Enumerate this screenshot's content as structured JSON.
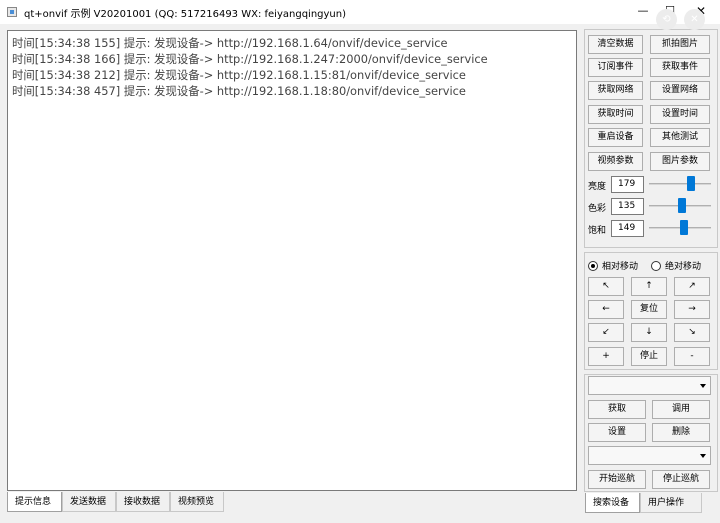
{
  "window": {
    "title": "qt+onvif 示例 V20201001 (QQ: 517216493 WX: feiyangqingyun)",
    "minimize": "—",
    "maximize": "☐",
    "close": "✕"
  },
  "overlay": {
    "icon1": "⟲",
    "icon2": "✕"
  },
  "log": {
    "lines": [
      "时间[15:34:38 155] 提示: 发现设备-> http://192.168.1.64/onvif/device_service",
      "时间[15:34:38 166] 提示: 发现设备-> http://192.168.1.247:2000/onvif/device_service",
      "时间[15:34:38 212] 提示: 发现设备-> http://192.168.1.15:81/onvif/device_service",
      "时间[15:34:38 457] 提示: 发现设备-> http://192.168.1.18:80/onvif/device_service"
    ]
  },
  "bottom_tabs": {
    "tab1": "提示信息",
    "tab2": "发送数据",
    "tab3": "接收数据",
    "tab4": "视频预览",
    "active": "提示信息"
  },
  "right_tabs": {
    "tab1": "搜索设备",
    "tab2": "用户操作",
    "active": "搜索设备"
  },
  "actions": {
    "clear_data": "清空数据",
    "capture_image": "抓拍图片",
    "subscribe_event": "订阅事件",
    "get_event": "获取事件",
    "get_network": "获取网络",
    "set_network": "设置网络",
    "get_time": "获取时间",
    "set_time": "设置时间",
    "reboot_device": "重启设备",
    "other_test": "其他测试",
    "video_params": "视频参数",
    "image_params": "图片参数"
  },
  "image_settings": {
    "brightness": {
      "label": "亮度",
      "value": "179",
      "level": 0.7
    },
    "color": {
      "label": "色彩",
      "value": "135",
      "level": 0.53
    },
    "saturation": {
      "label": "饱和",
      "value": "149",
      "level": 0.58
    }
  },
  "ptz": {
    "relative_label": "相对移动",
    "absolute_label": "绝对移动",
    "mode": "relative",
    "up_left": "↖",
    "up": "↑",
    "up_right": "↗",
    "left": "←",
    "reset": "复位",
    "right": "→",
    "down_left": "↙",
    "down": "↓",
    "down_right": "↘",
    "zoom_in": "+",
    "stop": "停止",
    "zoom_out": "-"
  },
  "preset": {
    "preset_select": "",
    "get": "获取",
    "call": "调用",
    "set": "设置",
    "delete": "删除",
    "tour_select": "",
    "start_tour": "开始巡航",
    "stop_tour": "停止巡航"
  }
}
